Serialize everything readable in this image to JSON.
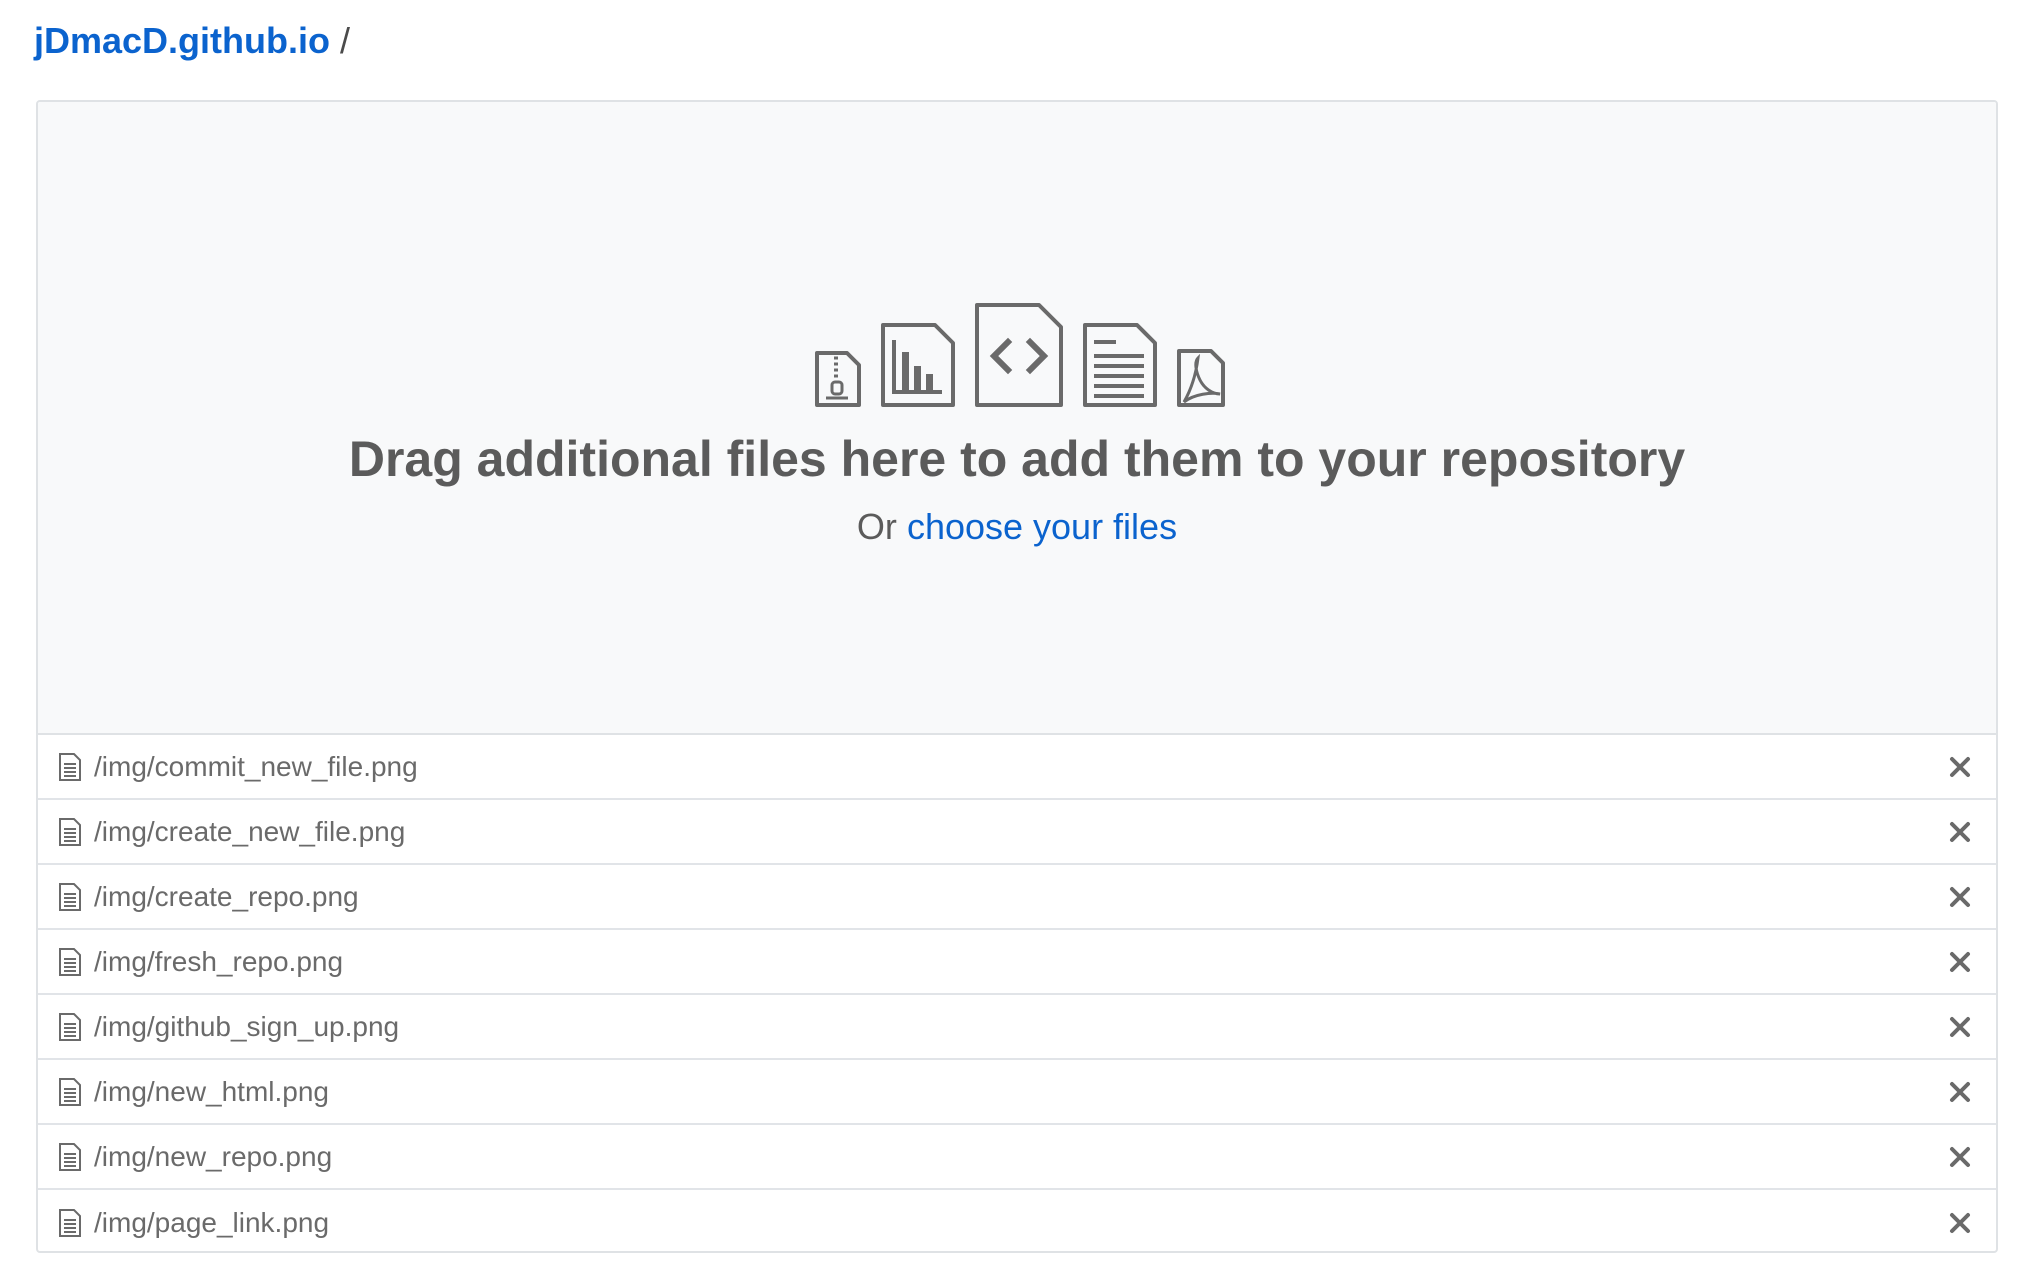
{
  "breadcrumb": {
    "repo": "jDmacD.github.io",
    "separator": "/"
  },
  "dropzone": {
    "icons": [
      "file-zip-icon",
      "graph-icon",
      "file-code-icon",
      "file-text-icon",
      "file-pdf-icon"
    ],
    "title": "Drag additional files here to add them to your repository",
    "or_text": "Or",
    "choose_link": "choose your files"
  },
  "files": [
    "/img/commit_new_file.png",
    "/img/create_new_file.png",
    "/img/create_repo.png",
    "/img/fresh_repo.png",
    "/img/github_sign_up.png",
    "/img/new_html.png",
    "/img/new_repo.png",
    "/img/page_link.png"
  ],
  "colors": {
    "link": "#0b63ce",
    "icon": "#6a6a6a",
    "dropzone_bg": "#f8f9fa",
    "border": "#dfe2e5"
  }
}
